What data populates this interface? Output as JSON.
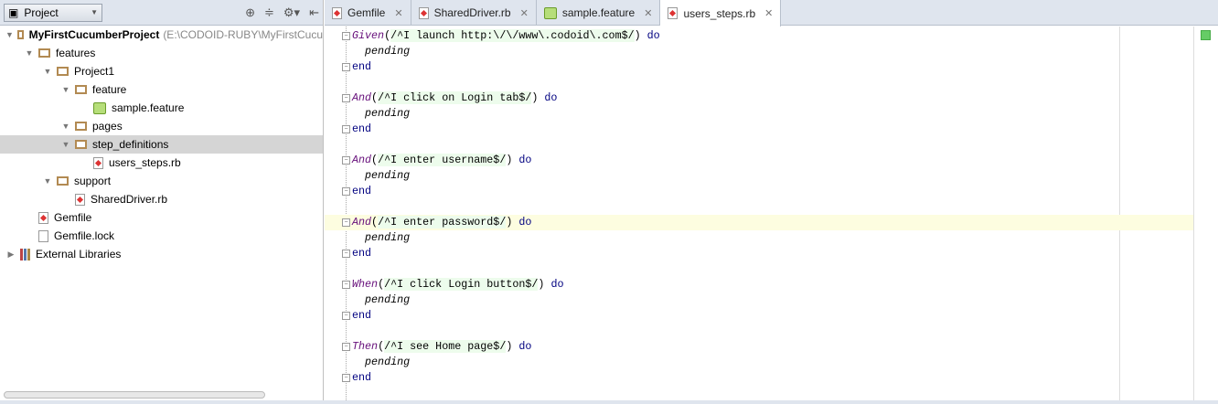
{
  "project_panel": {
    "selector": "Project",
    "tree": [
      {
        "label": "MyFirstCucumberProject",
        "path": "(E:\\CODOID-RUBY\\MyFirstCucu",
        "level": 0,
        "type": "folder",
        "expanded": true,
        "bold": true
      },
      {
        "label": "features",
        "level": 1,
        "type": "folder",
        "expanded": true
      },
      {
        "label": "Project1",
        "level": 2,
        "type": "folder",
        "expanded": true
      },
      {
        "label": "feature",
        "level": 3,
        "type": "folder",
        "expanded": true
      },
      {
        "label": "sample.feature",
        "level": 4,
        "type": "feature"
      },
      {
        "label": "pages",
        "level": 3,
        "type": "folder"
      },
      {
        "label": "step_definitions",
        "level": 3,
        "type": "folder",
        "expanded": true,
        "selected": true
      },
      {
        "label": "users_steps.rb",
        "level": 4,
        "type": "rb"
      },
      {
        "label": "support",
        "level": 2,
        "type": "folder",
        "expanded": true
      },
      {
        "label": "SharedDriver.rb",
        "level": 3,
        "type": "rb"
      },
      {
        "label": "Gemfile",
        "level": 1,
        "type": "rb"
      },
      {
        "label": "Gemfile.lock",
        "level": 1,
        "type": "file"
      },
      {
        "label": "External Libraries",
        "level": 0,
        "type": "lib",
        "collapsed": true
      }
    ]
  },
  "tabs": [
    {
      "label": "Gemfile",
      "icon": "ruby-file-icon"
    },
    {
      "label": "SharedDriver.rb",
      "icon": "ruby-file-icon"
    },
    {
      "label": "sample.feature",
      "icon": "cucumber-feature-icon"
    },
    {
      "label": "users_steps.rb",
      "icon": "step-definitions-icon",
      "active": true
    }
  ],
  "code": [
    {
      "kw": "Given",
      "rx": "/^I launch http:\\/\\/www\\.codoid\\.com$/",
      "do": "do"
    },
    {
      "kw": "And",
      "rx": "/^I click on Login tab$/",
      "do": "do"
    },
    {
      "kw": "And",
      "rx": "/^I enter username$/",
      "do": "do"
    },
    {
      "kw": "And",
      "rx": "/^I enter password$/",
      "do": "do",
      "current": true
    },
    {
      "kw": "When",
      "rx": "/^I click Login button$/",
      "do": "do"
    },
    {
      "kw": "Then",
      "rx": "/^I see Home page$/",
      "do": "do"
    }
  ],
  "pending": "pending",
  "end": "end",
  "colors": {
    "keyword": "#660e7a",
    "do_end": "#000080",
    "regex_bg": "#edfcec",
    "current_line": "#fdfde0",
    "selection": "#d5d5d5"
  }
}
